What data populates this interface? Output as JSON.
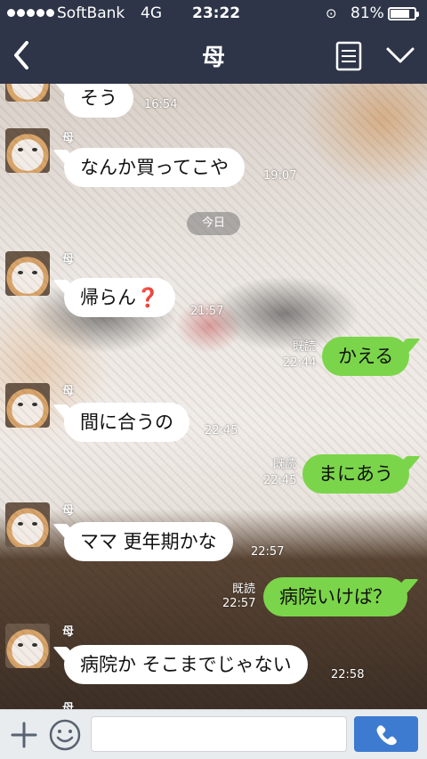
{
  "status": {
    "carrier": "SoftBank",
    "network": "4G",
    "time": "23:22",
    "battery": "81%",
    "battery_level": 0.81
  },
  "header": {
    "title": "母",
    "back_icon": "chevron-left-icon",
    "notes_icon": "notes-icon",
    "menu_icon": "chevron-down-icon"
  },
  "chat": {
    "date_separator": "今日",
    "messages": [
      {
        "side": "in",
        "sender": "",
        "text": "そう",
        "time": "16:54",
        "read": ""
      },
      {
        "side": "in",
        "sender": "母",
        "text": "なんか買ってこや",
        "time": "19:07",
        "read": ""
      },
      {
        "side": "in",
        "sender": "母",
        "text": "帰らん",
        "emoji": "❓",
        "time": "21:57",
        "read": ""
      },
      {
        "side": "out",
        "sender": "",
        "text": "かえる",
        "time": "22:44",
        "read": "既読"
      },
      {
        "side": "in",
        "sender": "母",
        "text": "間に合うの",
        "time": "22:45",
        "read": ""
      },
      {
        "side": "out",
        "sender": "",
        "text": "まにあう",
        "time": "22:45",
        "read": "既読"
      },
      {
        "side": "in",
        "sender": "母",
        "text": "ママ 更年期かな",
        "time": "22:57",
        "read": ""
      },
      {
        "side": "out",
        "sender": "",
        "text": "病院いけば？",
        "time": "22:57",
        "read": "既読"
      },
      {
        "side": "in",
        "sender": "母",
        "text": "病院か そこまでじゃない",
        "time": "22:58",
        "read": ""
      }
    ]
  },
  "input": {
    "placeholder": "",
    "plus_icon": "plus-icon",
    "sticker_icon": "smiley-icon",
    "call_icon": "phone-icon"
  },
  "colors": {
    "header_bg": "#2e3548",
    "outgoing_bubble": "#7bd54a",
    "incoming_bubble": "#ffffff",
    "call_button": "#3d7bd0"
  }
}
